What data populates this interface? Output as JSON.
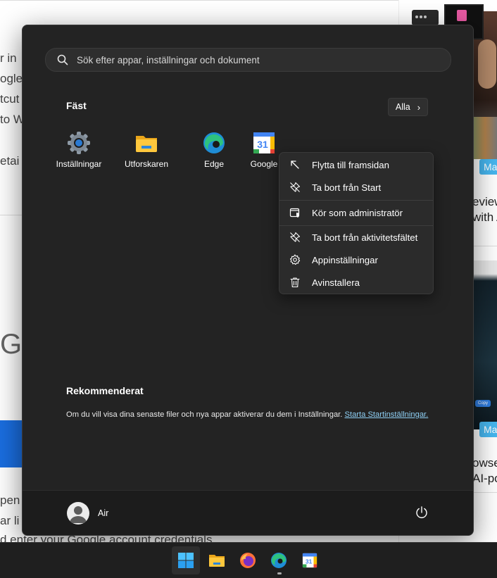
{
  "background": {
    "left_fragments": [
      "r in",
      "ogle",
      "tcut",
      "to W",
      "etai"
    ],
    "big_fragment": "Go",
    "bottom_fragments": [
      "pen",
      "ar li",
      "d enter your Google account credentials"
    ],
    "right_fragments": [
      "eview",
      "with A",
      "owse",
      "AI-po"
    ],
    "tags": [
      "Ma",
      "Ma"
    ],
    "thumb_button": "Copy"
  },
  "start_menu": {
    "search": {
      "placeholder": "Sök efter appar, inställningar och dokument"
    },
    "pinned": {
      "title": "Fäst",
      "all_label": "Alla",
      "apps": [
        {
          "label": "Inställningar",
          "icon": "settings-gear-icon"
        },
        {
          "label": "Utforskaren",
          "icon": "file-explorer-folder-icon"
        },
        {
          "label": "Edge",
          "icon": "edge-browser-icon"
        },
        {
          "label": "Google",
          "icon": "google-calendar-icon",
          "icon_text": "31"
        }
      ]
    },
    "recommended": {
      "title": "Rekommenderat",
      "text": "Om du vill visa dina senaste filer och nya appar aktiverar du dem i Inställningar. ",
      "link": "Starta Startinställningar."
    },
    "user": {
      "name": "Air"
    }
  },
  "context_menu": {
    "items": [
      {
        "label": "Flytta till framsidan",
        "icon": "arrow-up-left-icon"
      },
      {
        "label": "Ta bort från Start",
        "icon": "unpin-icon"
      },
      {
        "label": "Kör som administratör",
        "icon": "shield-window-icon"
      },
      {
        "label": "Ta bort från aktivitetsfältet",
        "icon": "unpin-taskbar-icon"
      },
      {
        "label": "Appinställningar",
        "icon": "gear-icon"
      },
      {
        "label": "Avinstallera",
        "icon": "trash-icon"
      }
    ]
  },
  "taskbar": {
    "items": [
      "start-icon",
      "file-explorer-icon",
      "firefox-icon",
      "edge-icon",
      "calendar-icon"
    ],
    "calendar_text": "31"
  },
  "colors": {
    "menu_bg": "#232323",
    "accent_link": "#8fd0f5",
    "tag_blue": "#47b7f0"
  }
}
